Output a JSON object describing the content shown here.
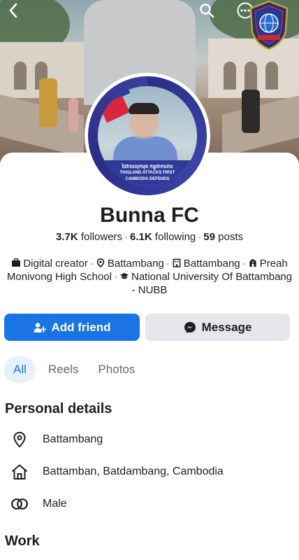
{
  "profile": {
    "name": "Bunna FC",
    "followers_count": "3.7K",
    "followers_label": "followers",
    "following_count": "6.1K",
    "following_label": "following",
    "posts_count": "59",
    "posts_label": "posts",
    "separator": "·"
  },
  "avatar_banner": {
    "line1": "ថៃវាយលុកមុន កម្ពុជាការពារ",
    "line2": "THAILAND ATTACKS FIRST",
    "line3": "CAMBODIA DEFENDS"
  },
  "about": {
    "items": [
      {
        "icon": "briefcase-icon",
        "text": "Digital creator"
      },
      {
        "icon": "location-pin-icon",
        "text": "Battambang"
      },
      {
        "icon": "building-icon",
        "text": "Battambang"
      },
      {
        "icon": "school-icon",
        "text": "Preah Monivong High School"
      },
      {
        "icon": "graduation-cap-icon",
        "text": "National University Of Battambang - NUBB"
      }
    ]
  },
  "actions": {
    "add_friend_label": "Add friend",
    "message_label": "Message"
  },
  "tabs": [
    {
      "label": "All",
      "active": true
    },
    {
      "label": "Reels",
      "active": false
    },
    {
      "label": "Photos",
      "active": false
    }
  ],
  "personal_details": {
    "title": "Personal details",
    "rows": [
      {
        "icon": "location-pin-icon",
        "text": "Battambang"
      },
      {
        "icon": "home-icon",
        "text": "Battamban, Batdambang, Cambodia"
      },
      {
        "icon": "gender-icon",
        "text": "Male"
      }
    ]
  },
  "work": {
    "title": "Work"
  },
  "colors": {
    "primary": "#1b74e4",
    "secondary_button": "#e4e6eb",
    "text": "#1c1e21",
    "muted": "#65676b",
    "tab_active_bg": "#e7f0fd"
  }
}
